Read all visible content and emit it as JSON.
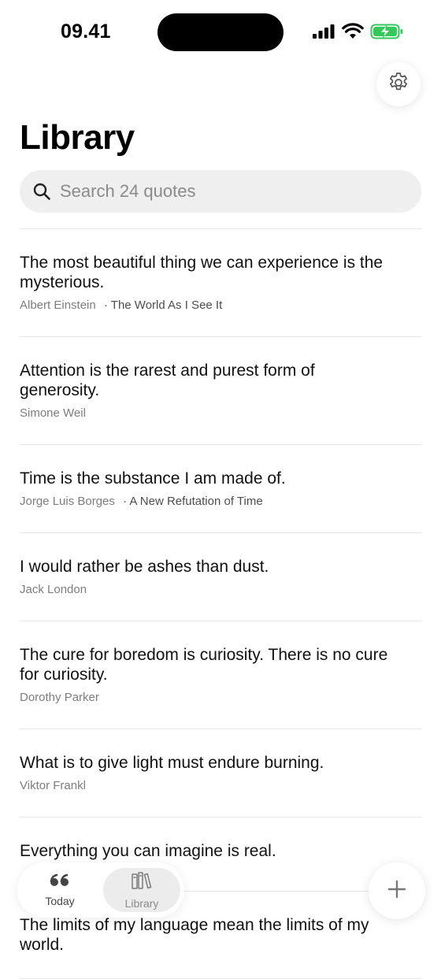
{
  "status_bar": {
    "time": "09.41"
  },
  "header": {
    "title": "Library",
    "settings_icon": "gear-icon"
  },
  "search": {
    "placeholder": "Search 24 quotes",
    "value": ""
  },
  "quotes": [
    {
      "text": "The most beautiful thing we can experience is the mysterious.",
      "author": "Albert Einstein",
      "source": "The World As I See It"
    },
    {
      "text": "Attention is the rarest and purest form of generosity.",
      "author": "Simone Weil",
      "source": ""
    },
    {
      "text": "Time is the substance I am made of.",
      "author": "Jorge Luis Borges",
      "source": "A New Refutation of Time"
    },
    {
      "text": "I would rather be ashes than dust.",
      "author": "Jack London",
      "source": ""
    },
    {
      "text": "The cure for boredom is curiosity. There is no cure for curiosity.",
      "author": "Dorothy Parker",
      "source": ""
    },
    {
      "text": "What is to give light must endure burning.",
      "author": "Viktor Frankl",
      "source": ""
    },
    {
      "text": "Everything you can imagine is real.",
      "author": "",
      "source": ""
    },
    {
      "text": "The limits of my language mean the limits of my world.",
      "author": "",
      "source": ""
    }
  ],
  "tab_bar": {
    "today_label": "Today",
    "library_label": "Library",
    "selected": "Library"
  },
  "colors": {
    "accent": "#000000",
    "battery": "#34c759"
  }
}
